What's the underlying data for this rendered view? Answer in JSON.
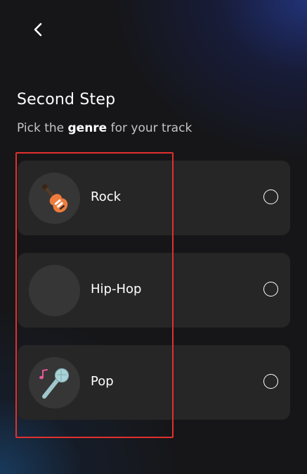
{
  "header": {
    "back_icon": "chevron-left-icon"
  },
  "step": {
    "title": "Second Step",
    "subtitle_prefix": "Pick the ",
    "subtitle_bold": "genre",
    "subtitle_suffix": " for your track"
  },
  "genres": [
    {
      "label": "Rock",
      "icon": "electric-guitar-icon",
      "selected": false
    },
    {
      "label": "Hip-Hop",
      "icon": "empty-placeholder",
      "selected": false
    },
    {
      "label": "Pop",
      "icon": "microphone-icon",
      "selected": false
    }
  ],
  "colors": {
    "background": "#161618",
    "card": "#262626",
    "icon_circle": "#363636",
    "highlight": "#e0302e"
  }
}
